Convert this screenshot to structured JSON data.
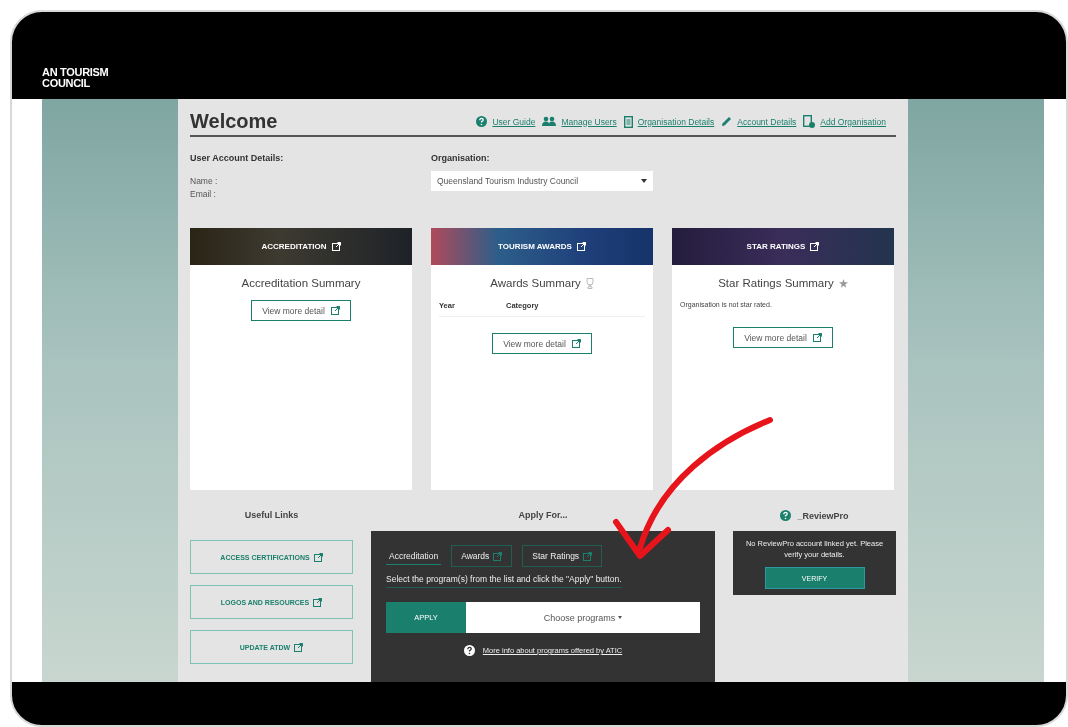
{
  "header": {
    "logo_lines": [
      "AN TOURISM",
      "COUNCIL"
    ]
  },
  "title": "Welcome",
  "top_links": [
    {
      "label": "User Guide",
      "kind": "help"
    },
    {
      "label": "Manage Users",
      "kind": "users"
    },
    {
      "label": "Organisation Details",
      "kind": "doc"
    },
    {
      "label": "Account Details",
      "kind": "pencil"
    },
    {
      "label": "Add Organisation",
      "kind": "doc-add"
    }
  ],
  "account": {
    "heading": "User Account Details:",
    "name_label": "Name :",
    "email_label": "Email :"
  },
  "organisation": {
    "heading": "Organisation:",
    "value": "Queensland Tourism Industry Council"
  },
  "cards": [
    {
      "kind": "plain",
      "banner": "ACCREDITATION",
      "title": "Accreditation Summary",
      "button": "View more detail"
    },
    {
      "kind": "awards",
      "banner": "TOURISM AWARDS",
      "title": "Awards Summary",
      "columns": [
        "Year",
        "Category"
      ],
      "button": "View more detail"
    },
    {
      "kind": "stars",
      "banner": "STAR RATINGS",
      "title": "Star Ratings Summary",
      "note": "Organisation is not star rated.",
      "button": "View more detail"
    }
  ],
  "useful_links": {
    "heading": "Useful Links",
    "links": [
      "ACCESS CERTIFICATIONS",
      "LOGOS AND RESOURCES",
      "UPDATE ATDW"
    ]
  },
  "apply": {
    "heading": "Apply For...",
    "tabs": [
      {
        "label": "Accreditation",
        "selected": true
      },
      {
        "label": "Awards",
        "selected": false
      },
      {
        "label": "Star Ratings",
        "selected": false
      }
    ],
    "instruction": "Select the program(s) from the list and click the \"Apply\" button.",
    "apply_button": "APPLY",
    "program_select": "Choose programs",
    "info_link": "More info about programs offered by ATIC"
  },
  "reviewpro": {
    "heading": "_ReviewPro",
    "message": "No ReviewPro account linked yet. Please verify your details.",
    "button": "VERIFY"
  }
}
